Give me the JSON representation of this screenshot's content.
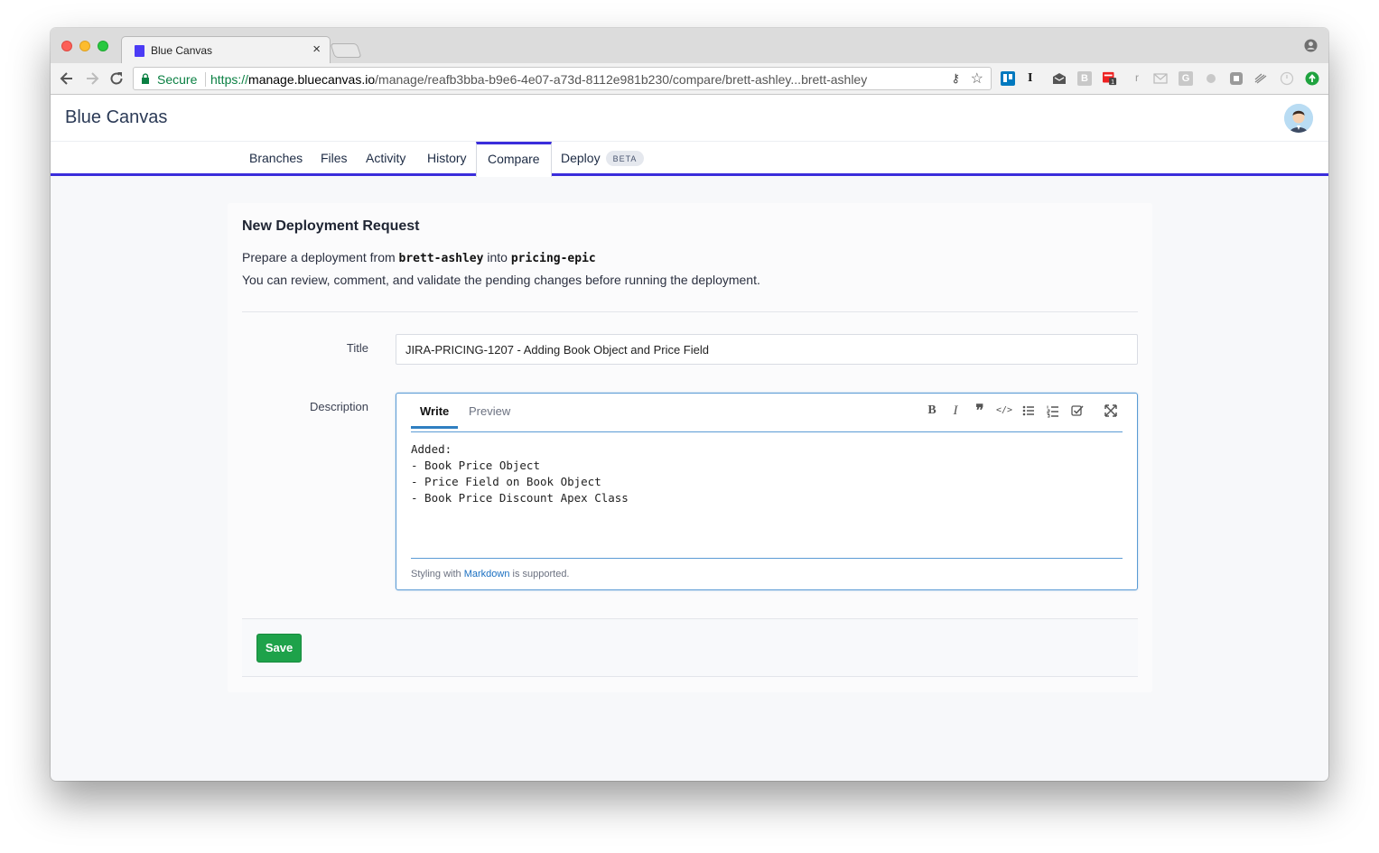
{
  "browser": {
    "tab_title": "Blue Canvas",
    "tab_close": "×",
    "secure_label": "Secure",
    "url_scheme": "https://",
    "url_host": "manage.bluecanvas.io",
    "url_path": "/manage/reafb3bba-b9e6-4e07-a73d-8112e981b230/compare/brett-ashley...brett-ashley",
    "extensions": [
      "trello-icon",
      "instapaper-icon",
      "inbox-icon",
      "buffer-icon",
      "calendar-icon",
      "readability-icon",
      "mail-icon",
      "grammarly-icon",
      "privacy-icon",
      "evernote-icon",
      "tabs-icon",
      "power-icon",
      "update-icon"
    ],
    "calendar_badge": "1",
    "instapaper_glyph": "I",
    "readability_glyph": "r",
    "buffer_glyph": "B",
    "grammarly_glyph": "G"
  },
  "app": {
    "brand": "Blue Canvas",
    "nav": {
      "branches": "Branches",
      "files": "Files",
      "activity": "Activity",
      "history": "History",
      "compare": "Compare",
      "deploy": "Deploy",
      "deploy_badge": "BETA"
    },
    "accent_color": "#3a2ddb"
  },
  "form": {
    "heading": "New Deployment Request",
    "intro_prefix": "Prepare a deployment from ",
    "source_branch": "brett-ashley",
    "intro_middle": " into ",
    "target_branch": "pricing-epic",
    "intro_line2": "You can review, comment, and validate the pending changes before running the deployment.",
    "title_label": "Title",
    "title_value": "JIRA-PRICING-1207 - Adding Book Object and Price Field",
    "description_label": "Description",
    "editor_tab_write": "Write",
    "editor_tab_preview": "Preview",
    "editor_tools": [
      "bold-icon",
      "italic-icon",
      "quote-icon",
      "code-icon",
      "bullet-list-icon",
      "numbered-list-icon",
      "task-list-icon",
      "fullscreen-icon"
    ],
    "description_value": "Added:\n- Book Price Object\n- Price Field on Book Object\n- Book Price Discount Apex Class",
    "help_prefix": "Styling with ",
    "help_link": "Markdown",
    "help_suffix": " is supported.",
    "save_label": "Save",
    "save_color": "#1ea24a"
  }
}
